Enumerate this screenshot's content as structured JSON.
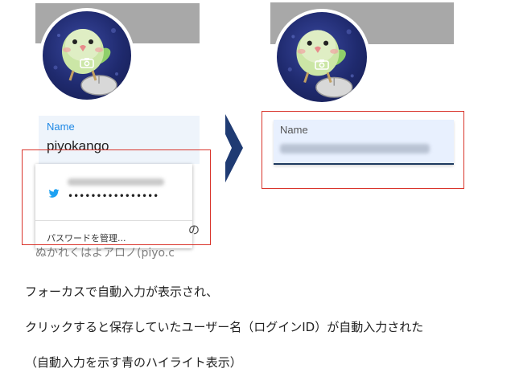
{
  "left_panel": {
    "name_label": "Name",
    "name_value": "piyokango",
    "autofill_dropdown": {
      "account_icon": "twitter-bird-icon",
      "password_mask": "••••••••••••••••",
      "manage_passwords_label": "パスワードを管理...",
      "overlapped_text_line1": "の",
      "overlapped_text_line2": "ぬかれくはよアロノ(piyo.c"
    }
  },
  "right_panel": {
    "name_label": "Name"
  },
  "caption": {
    "line1": "フォーカスで自動入力が表示され、",
    "line2": "クリックすると保存していたユーザー名（ログインID）が自動入力された",
    "line3": "（自動入力を示す青のハイライト表示）"
  },
  "colors": {
    "accent_blue": "#1e88e5",
    "autofill_highlight": "#e8f0fe",
    "annotation_red": "#d9342b",
    "arrow_navy": "#1f3b73",
    "banner_gray": "#a8a8a8"
  },
  "icons": {
    "camera": "camera-icon",
    "twitter": "twitter-bird-icon",
    "arrow": "right-arrow-icon"
  }
}
